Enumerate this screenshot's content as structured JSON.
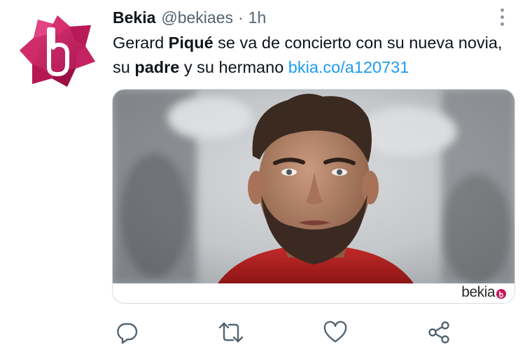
{
  "tweet": {
    "display_name": "Bekia",
    "handle": "@bekiaes",
    "separator": "·",
    "time": "1h",
    "text": {
      "t1": "Gerard ",
      "b1": "Piqué",
      "t2": " se va de concierto con su nueva novia, su ",
      "b2": "padre",
      "t3": " y su hermano ",
      "link": "bkia.co/a120731"
    }
  },
  "card": {
    "brand": "bekia",
    "badge_glyph": "b"
  },
  "actions": [
    "reply-icon",
    "retweet-icon",
    "like-icon",
    "share-icon"
  ],
  "colors": {
    "link": "#1d9bf0",
    "secondary_text": "#536471",
    "icon": "#536471",
    "brand_magenta": "#c2185b"
  }
}
